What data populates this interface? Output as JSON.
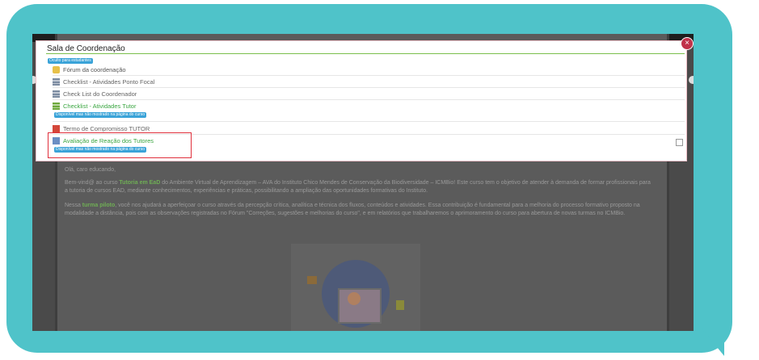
{
  "modal": {
    "title": "Sala de Coordenação",
    "hidden_badge": "Oculto para estudantes",
    "close_symbol": "×",
    "items": [
      {
        "label": "Fórum da coordenação",
        "icon": "forum-icon",
        "color": "#555555"
      },
      {
        "label": "Checklist - Atividades Ponto Focal",
        "icon": "checklist-icon",
        "color": "#666666"
      },
      {
        "label": "Check List do Coordenador",
        "icon": "checklist-icon",
        "color": "#666666"
      },
      {
        "label": "Checklist - Atividades Tutor",
        "icon": "checklist-icon",
        "color": "#3aa641",
        "badge": "Disponível mas não mostrado na página do curso"
      },
      {
        "label": "Termo de Compromisso TUTOR",
        "icon": "pdf-icon",
        "color": "#666666"
      },
      {
        "label": "Avaliação de Reação dos Tutores",
        "icon": "feedback-icon",
        "color": "#3aa641",
        "badge": "Disponível mas não mostrado na página do curso"
      }
    ]
  },
  "background": {
    "greeting": "Olá, caro educando,",
    "p1_pre": "Bem-vind@ ao curso ",
    "p1_course": "Tutoria em EaD",
    "p1_post": " do Ambiente Virtual de Aprendizagem – AVA do Instituto Chico Mendes de Conservação da Biodiversidade – ICMBio! Este curso tem o objetivo de atender à demanda de formar profissionais para a tutoria de cursos EAD, mediante conhecimentos, experiências e práticas, possibilitando a ampliação das oportunidades formativas do Instituto.",
    "p2_pre": "Nessa ",
    "p2_bold": "turma piloto",
    "p2_post": ", você nos ajudará a aperfeiçoar o curso através da percepção crítica, analítica e técnica dos fluxos, conteúdos e atividades. Essa contribuição é fundamental para a melhoria do processo formativo proposto na modalidade a distância, pois com as observações registradas no Fórum \"Correções, sugestões e melhorias do curso\", e em relatórios que trabalharemos o aprimoramento do curso para abertura de novas turmas no ICMBio."
  },
  "colors": {
    "bubble": "#4fc3c9",
    "accent_green": "#3aa641",
    "highlight_red": "#e0303c",
    "badge_blue": "#3aa3d8"
  }
}
